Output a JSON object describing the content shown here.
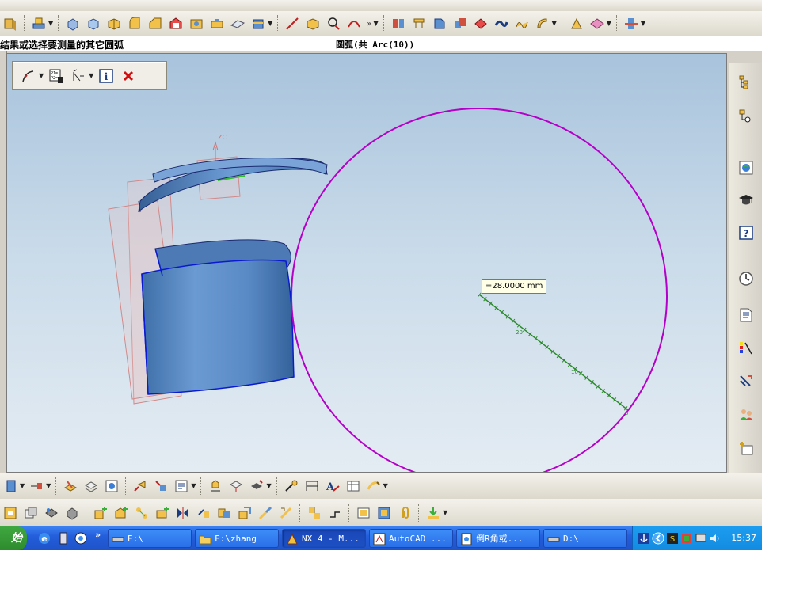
{
  "cue": {
    "prompt": "结果或选择要测量的其它圆弧",
    "selection": "圆弧(共 Arc(10))"
  },
  "viewport": {
    "dimension_label": "=28.0000 mm",
    "wcs_axis_label": "ZC",
    "ruler_ticks": [
      "20",
      "10",
      "0"
    ]
  },
  "float_toolbar": {
    "items": [
      "measure-arc-icon",
      "points-list-icon",
      "measure-type-icon",
      "info-icon",
      "close-icon"
    ]
  },
  "resource_bar": {
    "items": [
      "assembly-navigator-icon",
      "part-navigator-icon",
      "web-browser-icon",
      "training-icon",
      "help-icon",
      "history-icon",
      "reuse-library-icon",
      "palette-icon",
      "process-studio-icon",
      "roles-icon",
      "system-scene-icon"
    ]
  },
  "taskbar": {
    "start_label": "始",
    "tasks": [
      {
        "label": "E:\\",
        "icon": "drive-icon"
      },
      {
        "label": "F:\\zhang",
        "icon": "folder-icon"
      },
      {
        "label": "NX 4 - M...",
        "icon": "nx-icon",
        "active": true
      },
      {
        "label": "AutoCAD ...",
        "icon": "autocad-icon"
      },
      {
        "label": "倒R角或...",
        "icon": "document-icon"
      },
      {
        "label": "D:\\",
        "icon": "drive-icon"
      }
    ],
    "clock": "15:37"
  },
  "colors": {
    "measure_circle": "#b400c8",
    "ruler": "#2a8a2a",
    "part_blue": "#5f8fc8",
    "edge_blue": "#0a1ad0",
    "datum_plane": "#e0a0a0"
  }
}
